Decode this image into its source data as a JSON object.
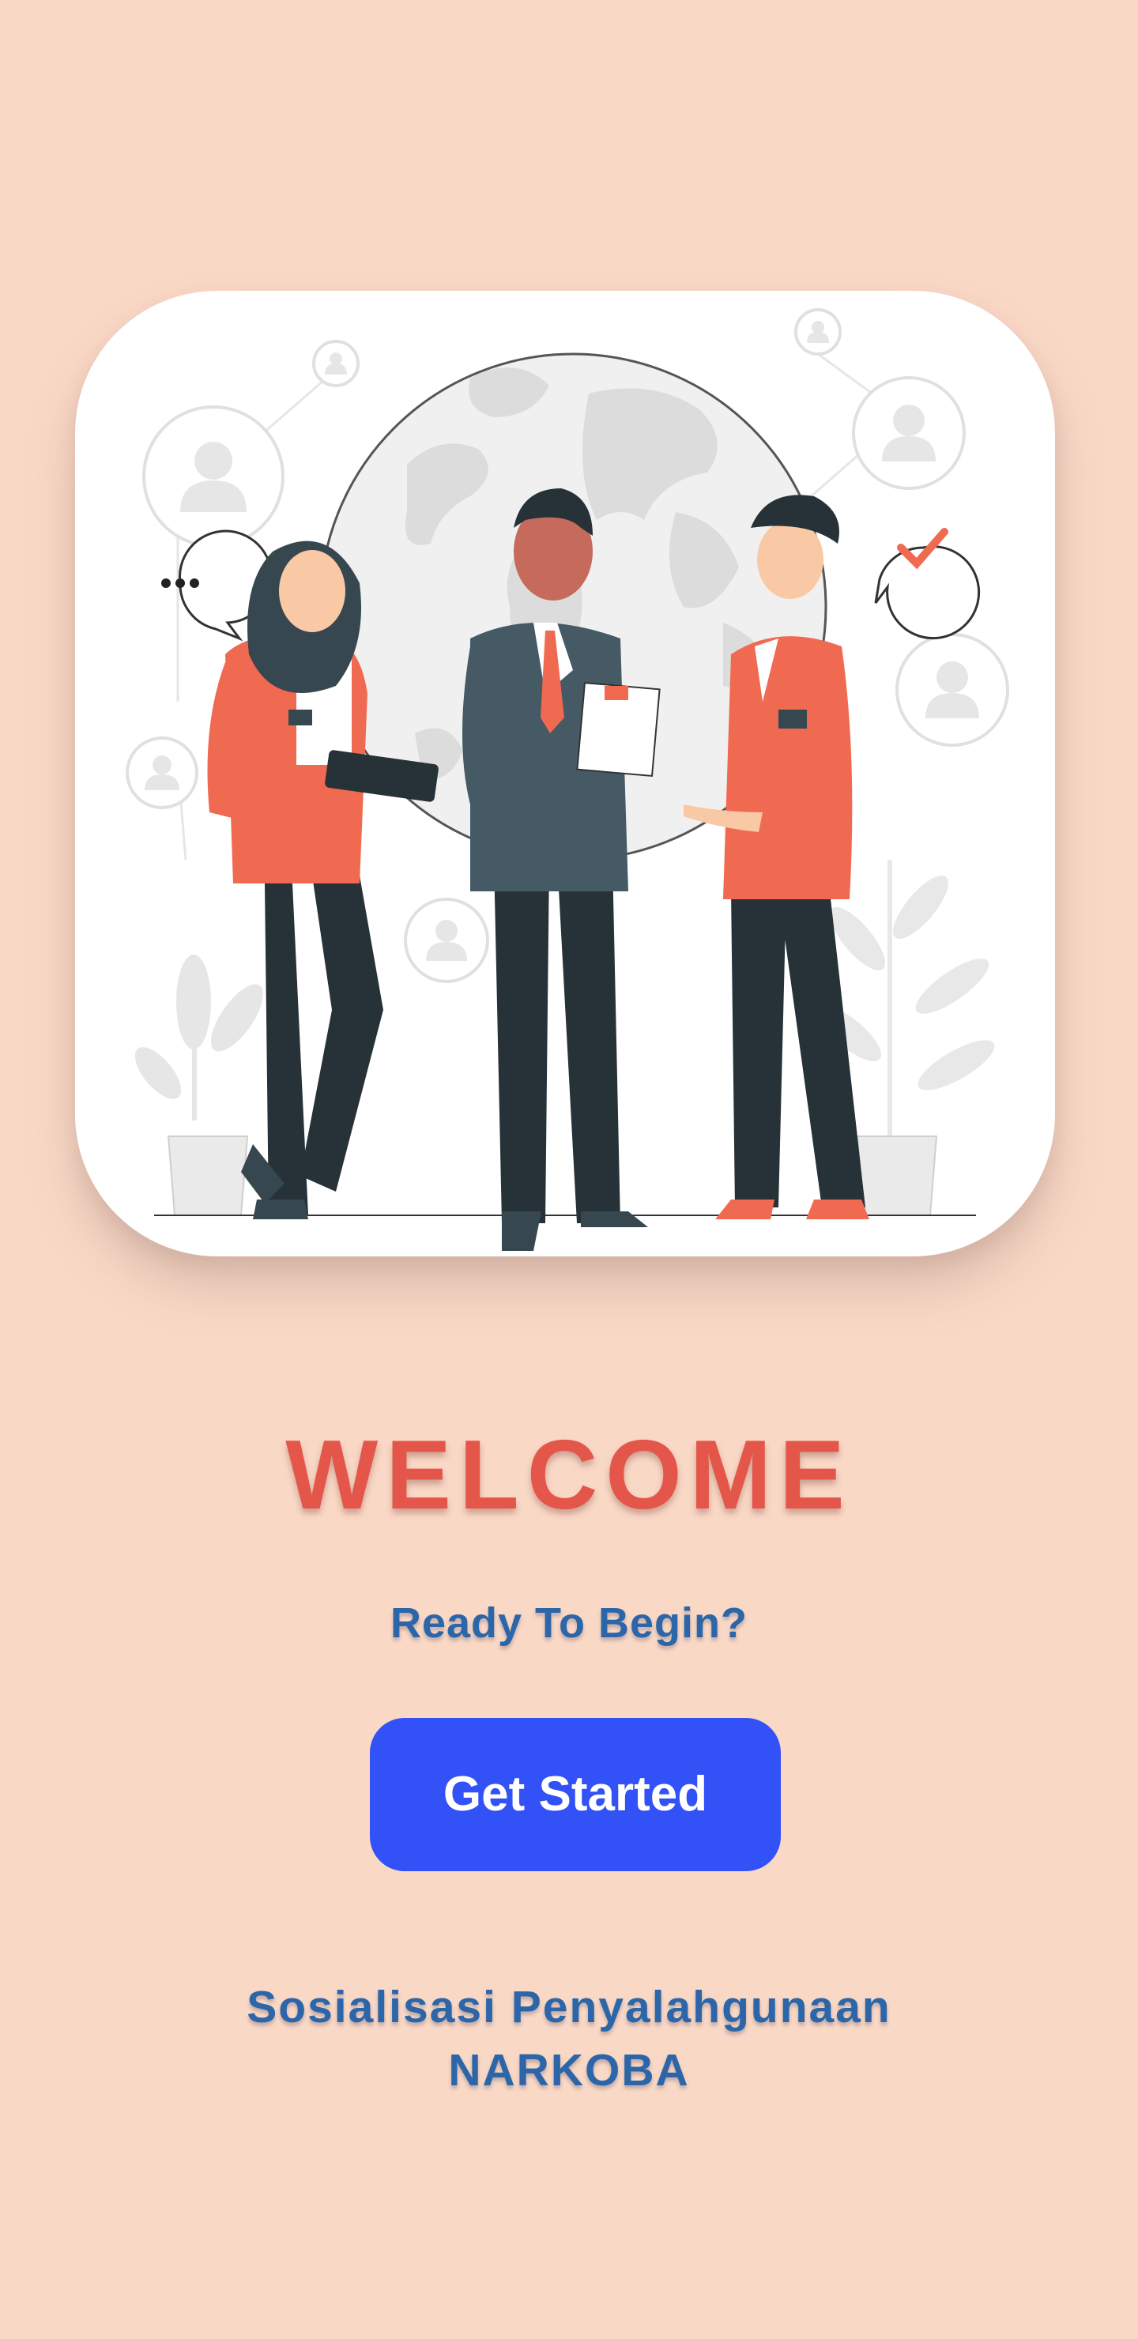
{
  "hero": {
    "illustration": "business-people-meeting-globe-illustration"
  },
  "welcome": {
    "title": "WELCOME",
    "subtitle": "Ready To Begin?"
  },
  "cta": {
    "label": "Get Started"
  },
  "footer": {
    "line1": "Sosialisasi Penyalahgunaan",
    "line2": "NARKOBA"
  },
  "colors": {
    "background": "#FAD8C6",
    "title": "#E4564A",
    "text_blue": "#2C66A8",
    "button": "#3251F6",
    "accent_red": "#F06A52",
    "dark_suit": "#455A64"
  }
}
